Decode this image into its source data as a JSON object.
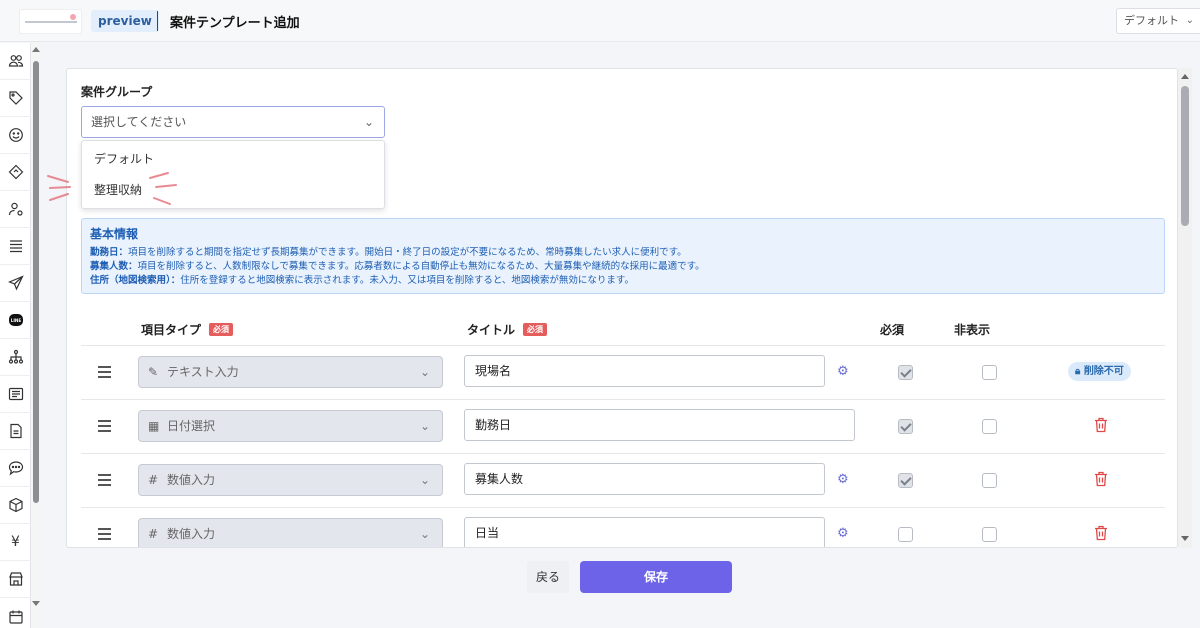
{
  "header": {
    "env_badge": "preview",
    "title": "案件テンプレート追加",
    "tenant_select": "デフォルト"
  },
  "sidebar": {
    "icons": [
      "users-icon",
      "tag-icon",
      "smile-icon",
      "ticket-icon",
      "user-gear-icon",
      "list-icon",
      "send-icon",
      "line-icon",
      "sitemap-icon",
      "news-icon",
      "document-icon",
      "chat-icon",
      "box-icon",
      "yen-icon",
      "store-icon",
      "calendar-icon"
    ],
    "yen_glyph": "¥",
    "line_label": "LINE"
  },
  "form": {
    "group_label": "案件グループ",
    "group_placeholder": "選択してください",
    "group_options": [
      "デフォルト",
      "整理収納"
    ]
  },
  "info": {
    "title": "基本情報",
    "lines": [
      {
        "key": "勤務日：",
        "text": "項目を削除すると期間を指定せず長期募集ができます。開始日・終了日の設定が不要になるため、常時募集したい求人に便利です。"
      },
      {
        "key": "募集人数：",
        "text": "項目を削除すると、人数制限なしで募集できます。応募者数による自動停止も無効になるため、大量募集や継続的な採用に最適です。"
      },
      {
        "key": "住所（地図検索用）：",
        "text": "住所を登録すると地図検索に表示されます。未入力、又は項目を削除すると、地図検索が無効になります。"
      }
    ]
  },
  "table": {
    "headers": {
      "type": "項目タイプ",
      "title": "タイトル",
      "required": "必須",
      "hidden": "非表示",
      "required_tag": "必須"
    },
    "rows": [
      {
        "type_icon": "pencil-icon",
        "type_glyph": "✎",
        "type": "テキスト入力",
        "title": "現場名",
        "gear": true,
        "required": true,
        "hidden": false,
        "action": "lock",
        "action_label": "削除不可"
      },
      {
        "type_icon": "calendar-icon",
        "type_glyph": "▦",
        "type": "日付選択",
        "title": "勤務日",
        "gear": false,
        "required": true,
        "hidden": false,
        "action": "delete"
      },
      {
        "type_icon": "hash-icon",
        "type_glyph": "#",
        "type": "数値入力",
        "title": "募集人数",
        "gear": true,
        "required": true,
        "hidden": false,
        "action": "delete"
      },
      {
        "type_icon": "hash-icon",
        "type_glyph": "#",
        "type": "数値入力",
        "title": "日当",
        "gear": true,
        "required": false,
        "hidden": false,
        "action": "delete"
      }
    ]
  },
  "footer": {
    "back_label": "戻る",
    "save_label": "保存"
  },
  "colors": {
    "accent": "#6c63e8",
    "info_text": "#1f5fb3",
    "required_tag": "#e55c5c",
    "delete_icon": "#e04848"
  }
}
